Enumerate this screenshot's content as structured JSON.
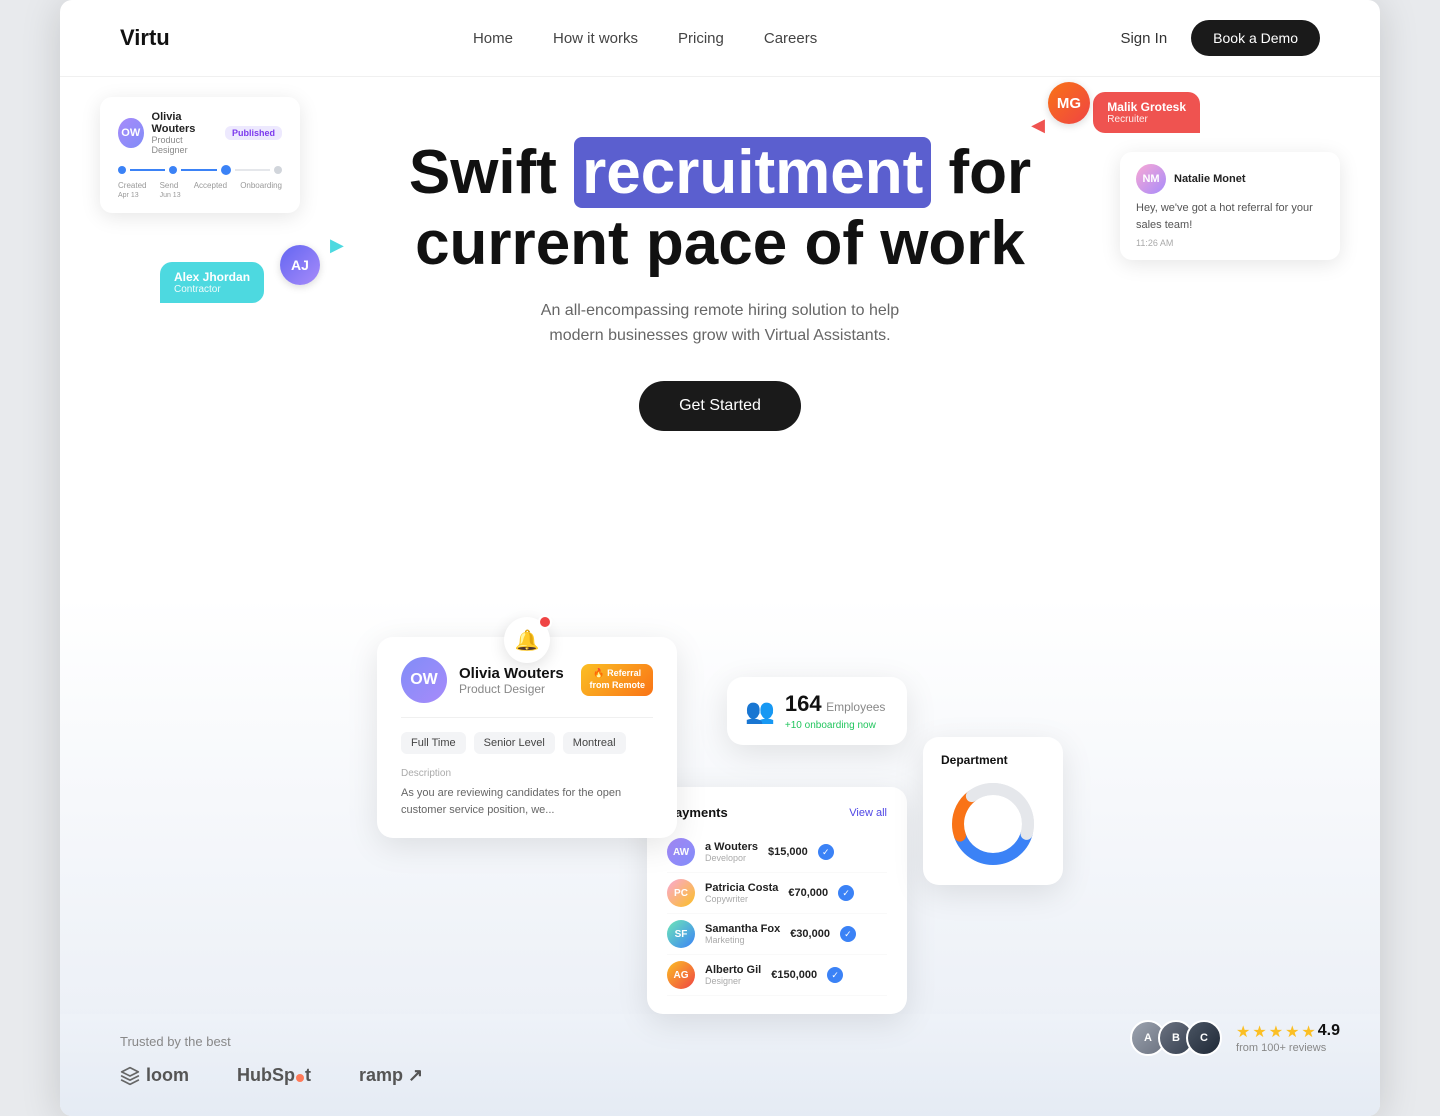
{
  "brand": {
    "logo": "Virtu"
  },
  "nav": {
    "links": [
      "Home",
      "How it works",
      "Pricing",
      "Careers"
    ],
    "sign_in": "Sign In",
    "book_demo": "Book a Demo"
  },
  "hero": {
    "title_prefix": "Swift ",
    "title_highlight": "recruitment",
    "title_suffix": " for current pace of work",
    "subtitle": "An all-encompassing remote hiring solution to help modern businesses grow with Virtual Assistants.",
    "cta": "Get Started"
  },
  "floating": {
    "profile_card": {
      "name": "Olivia Wouters",
      "role": "Product Designer",
      "badge": "Published",
      "steps": [
        "Created",
        "Send",
        "Accepted",
        "Onboarding"
      ]
    },
    "bubble_left": {
      "name": "Alex Jhordan",
      "type": "Contractor"
    },
    "bubble_right": {
      "name": "Malik Grotesk",
      "type": "Recruiter"
    },
    "message_card": {
      "name": "Natalie Monet",
      "message": "Hey, we've got a hot referral for your sales team!",
      "time": "11:26 AM"
    }
  },
  "candidate_card": {
    "name": "Olivia Wouters",
    "role": "Product Desiger",
    "referral": "Referral\nfrom Remote",
    "tags": [
      "Full Time",
      "Senior Level",
      "Montreal"
    ],
    "description_label": "Description",
    "description": "As you are reviewing candidates for the open customer service position, we..."
  },
  "employees_card": {
    "count": "164",
    "label": "Employees",
    "sub": "+10 onboarding now"
  },
  "payments_card": {
    "title": "payments",
    "view_all": "View all",
    "rows": [
      {
        "name": "a Wouters",
        "role": "Developor",
        "amount": "$15,000"
      },
      {
        "name": "Patricia Costa",
        "role": "Copywriter",
        "amount": "€70,000"
      },
      {
        "name": "Samantha Fox",
        "role": "Marketing",
        "amount": "€30,000"
      },
      {
        "name": "Alberto Gil",
        "role": "Designer",
        "amount": "€150,000"
      }
    ]
  },
  "department_card": {
    "title": "Department"
  },
  "trusted": {
    "label": "Trusted by the best",
    "brands": [
      "loom",
      "HubSpot",
      "ramp"
    ]
  },
  "reviews": {
    "rating": "4.9",
    "from": "from 100+ reviews",
    "avatars": [
      "A",
      "B",
      "C"
    ]
  }
}
